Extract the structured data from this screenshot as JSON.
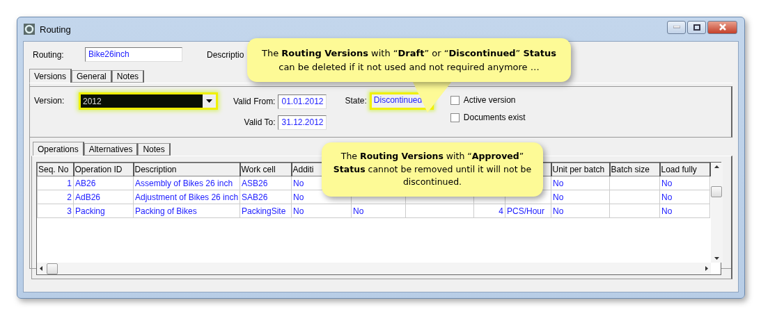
{
  "window": {
    "title": "Routing"
  },
  "routing": {
    "label": "Routing:",
    "value": "Bike26inch",
    "description_label": "Descriptio"
  },
  "tabs": [
    {
      "label": "Versions",
      "selected": true
    },
    {
      "label": "General",
      "selected": false
    },
    {
      "label": "Notes",
      "selected": false
    }
  ],
  "version": {
    "label": "Version:",
    "value": "2012",
    "highlighted": true,
    "valid_from_label": "Valid From:",
    "valid_from": "01.01.2012",
    "valid_to_label": "Valid To:",
    "valid_to": "31.12.2012",
    "state_label": "State:",
    "state": "Discontinued",
    "state_highlighted": true,
    "checkboxes": [
      {
        "label": "Active version",
        "checked": false
      },
      {
        "label": "Documents exist",
        "checked": false
      }
    ]
  },
  "inner_tabs": [
    {
      "label": "Operations",
      "selected": true
    },
    {
      "label": "Alternatives",
      "selected": false
    },
    {
      "label": "Notes",
      "selected": false
    }
  ],
  "table": {
    "columns": [
      "Seq. No",
      "Operation ID",
      "Description",
      "Work cell",
      "Additi",
      "",
      "",
      "",
      "",
      "Unit per batch",
      "Batch size",
      "Load fully"
    ],
    "rows": [
      [
        "1",
        "AB26",
        "Assembly of Bikes 26 inch",
        "ASB26",
        "No",
        "",
        "",
        "",
        "",
        "No",
        "",
        "No"
      ],
      [
        "2",
        "AdB26",
        "Adjustment of Bikes 26 inch",
        "SAB26",
        "No",
        "",
        "",
        "",
        "",
        "No",
        "",
        "No"
      ],
      [
        "3",
        "Packing",
        "Packing of Bikes",
        "PackingSite",
        "No",
        "No",
        "",
        "4",
        "PCS/Hour",
        "No",
        "",
        "No"
      ]
    ]
  },
  "callouts": [
    {
      "text": "The **Routing Versions** with “**Draft**” or “**Discontinued**”  **Status** can be deleted if it not used and not required anymore …",
      "pointer": true
    },
    {
      "text": "The **Routing Versions** with “**Approved**” **Status** cannot be removed until it will not be discontinued."
    }
  ]
}
